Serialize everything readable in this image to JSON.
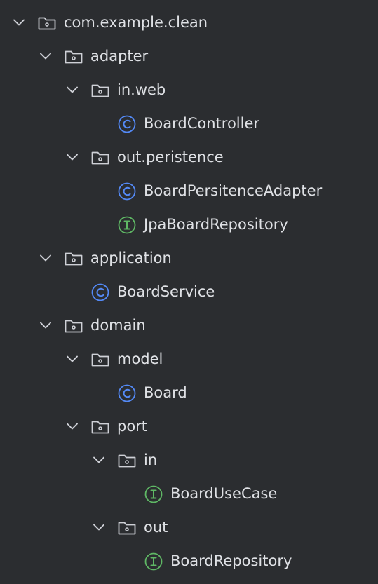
{
  "colors": {
    "background": "#2b2d30",
    "text": "#dfe1e5",
    "icon_outline": "#ced0d6",
    "class_icon": "#548af7",
    "interface_icon": "#5fb865"
  },
  "tree": [
    {
      "label": "com.example.clean",
      "kind": "package",
      "depth": 0,
      "expanded": true,
      "icon": "folder-icon"
    },
    {
      "label": "adapter",
      "kind": "package",
      "depth": 1,
      "expanded": true,
      "icon": "folder-icon"
    },
    {
      "label": "in.web",
      "kind": "package",
      "depth": 2,
      "expanded": true,
      "icon": "folder-icon"
    },
    {
      "label": "BoardController",
      "kind": "class",
      "depth": 3,
      "icon": "class-icon"
    },
    {
      "label": "out.peristence",
      "kind": "package",
      "depth": 2,
      "expanded": true,
      "icon": "folder-icon"
    },
    {
      "label": "BoardPersitenceAdapter",
      "kind": "class",
      "depth": 3,
      "icon": "class-icon"
    },
    {
      "label": "JpaBoardRepository",
      "kind": "interface",
      "depth": 3,
      "icon": "interface-icon"
    },
    {
      "label": "application",
      "kind": "package",
      "depth": 1,
      "expanded": true,
      "icon": "folder-icon"
    },
    {
      "label": "BoardService",
      "kind": "class",
      "depth": 2,
      "icon": "class-icon"
    },
    {
      "label": "domain",
      "kind": "package",
      "depth": 1,
      "expanded": true,
      "icon": "folder-icon"
    },
    {
      "label": "model",
      "kind": "package",
      "depth": 2,
      "expanded": true,
      "icon": "folder-icon"
    },
    {
      "label": "Board",
      "kind": "class",
      "depth": 3,
      "icon": "class-icon"
    },
    {
      "label": "port",
      "kind": "package",
      "depth": 2,
      "expanded": true,
      "icon": "folder-icon"
    },
    {
      "label": "in",
      "kind": "package",
      "depth": 3,
      "expanded": true,
      "icon": "folder-icon"
    },
    {
      "label": "BoardUseCase",
      "kind": "interface",
      "depth": 4,
      "icon": "interface-icon"
    },
    {
      "label": "out",
      "kind": "package",
      "depth": 3,
      "expanded": true,
      "icon": "folder-icon"
    },
    {
      "label": "BoardRepository",
      "kind": "interface",
      "depth": 4,
      "icon": "interface-icon"
    }
  ]
}
